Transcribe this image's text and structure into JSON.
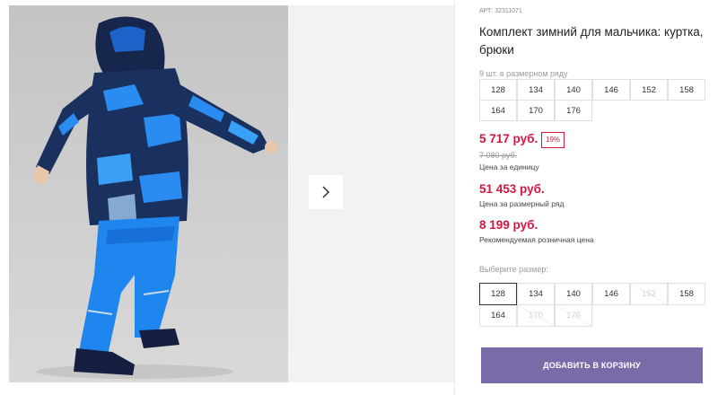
{
  "gallery": {
    "next_icon": "chevron-right-icon"
  },
  "product": {
    "article": "АРТ: 32311071",
    "title": "Комплект зимний для мальчика: куртка, брюки",
    "range_note": "9 шт. в размерном ряду",
    "range_sizes": [
      "128",
      "134",
      "140",
      "146",
      "152",
      "158",
      "164",
      "170",
      "176"
    ]
  },
  "pricing": {
    "unit_price": "5 717 руб.",
    "discount": "19%",
    "old_price": "7 080 руб.",
    "unit_caption": "Цена за единицу",
    "range_price": "51 453 руб.",
    "range_caption": "Цена за размерный ряд",
    "retail_price": "8 199 руб.",
    "retail_caption": "Рекомендуемая розничная цена"
  },
  "size_selector": {
    "label": "Выберите размер:",
    "options": [
      {
        "size": "128",
        "state": "selected"
      },
      {
        "size": "134",
        "state": "available"
      },
      {
        "size": "140",
        "state": "available"
      },
      {
        "size": "146",
        "state": "available"
      },
      {
        "size": "152",
        "state": "unavailable"
      },
      {
        "size": "158",
        "state": "available"
      },
      {
        "size": "164",
        "state": "available"
      },
      {
        "size": "170",
        "state": "unavailable"
      },
      {
        "size": "176",
        "state": "unavailable"
      }
    ]
  },
  "cart": {
    "button_label": "ДОБАВИТЬ В КОРЗИНУ"
  },
  "colors": {
    "price_red": "#d6163f",
    "cart_button": "#7b6aa8"
  }
}
